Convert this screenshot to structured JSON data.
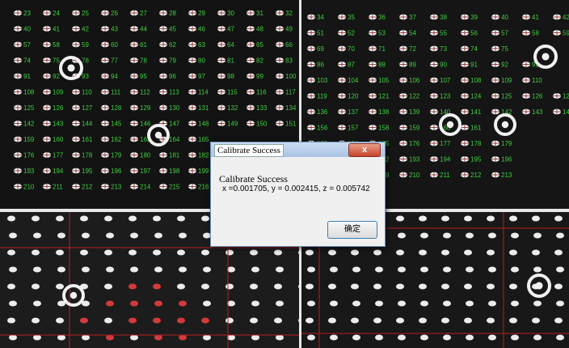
{
  "dialog": {
    "title": "Calibrate Success",
    "close_label": "x",
    "message_title": "Calibrate Success",
    "message_values": "x =0.001705, y = 0.002415, z = 0.005742",
    "ok_label": "确定"
  },
  "colors": {
    "label_green": "#3ecf3e",
    "target_white": "#f0f0f0",
    "grid_red": "#b81e1e",
    "divider": "#e8e8e8"
  },
  "panes": {
    "top_left": {
      "rows": [
        [
          23,
          24,
          25,
          26,
          27,
          28,
          29,
          30,
          31,
          32
        ],
        [
          40,
          41,
          42,
          43,
          44,
          45,
          46,
          47,
          48,
          49
        ],
        [
          57,
          58,
          59,
          60,
          61,
          62,
          63,
          64,
          65,
          66
        ],
        [
          74,
          75,
          76,
          77,
          78,
          79,
          80,
          81,
          82,
          83
        ],
        [
          91,
          92,
          93,
          94,
          95,
          96,
          97,
          98,
          99,
          100
        ],
        [
          108,
          109,
          110,
          111,
          112,
          113,
          114,
          115,
          116,
          117
        ],
        [
          125,
          126,
          127,
          128,
          129,
          130,
          131,
          132,
          133,
          134
        ],
        [
          142,
          143,
          144,
          145,
          146,
          147,
          148,
          149,
          150,
          151
        ],
        [
          159,
          160,
          161,
          162,
          163,
          164,
          165
        ],
        [
          176,
          177,
          178,
          179,
          180,
          181,
          182
        ],
        [
          193,
          194,
          195,
          196,
          197,
          198,
          199
        ],
        [
          210,
          211,
          212,
          213,
          214,
          215,
          216
        ]
      ]
    },
    "top_right": {
      "rows": [
        [
          34,
          35,
          36,
          37,
          38,
          39,
          40,
          41,
          42
        ],
        [
          51,
          52,
          53,
          54,
          55,
          56,
          57,
          58,
          59
        ],
        [
          69,
          70,
          71,
          72,
          73,
          74,
          75
        ],
        [
          86,
          87,
          88,
          89,
          90,
          91,
          92,
          93
        ],
        [
          103,
          104,
          105,
          106,
          107,
          108,
          109,
          110
        ],
        [
          119,
          120,
          121,
          122,
          123,
          124,
          125,
          126,
          127
        ],
        [
          136,
          137,
          138,
          139,
          140,
          141,
          142,
          143,
          144
        ],
        [
          156,
          157,
          158,
          159,
          160,
          161
        ],
        [
          173,
          174,
          175,
          176,
          177,
          178,
          179
        ],
        [
          190,
          191,
          192,
          193,
          194,
          195,
          196
        ],
        [
          207,
          208,
          209,
          210,
          211,
          212,
          213
        ]
      ]
    }
  }
}
